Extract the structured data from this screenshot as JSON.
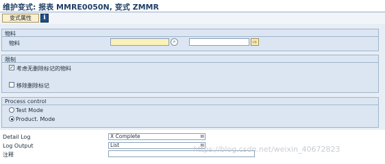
{
  "window": {
    "title": "维护变式: 报表 MMRE0050N, 变式 ZMMR"
  },
  "toolbar": {
    "attributes_button": "变式属性",
    "info_icon_glyph": "i"
  },
  "group_material": {
    "title": "物料",
    "field_label": "物料",
    "from_value": "",
    "to_value": "",
    "match_icon_glyph": "⌕",
    "multiple_icon_glyph": "⇨"
  },
  "group_restrict": {
    "title": "限制",
    "check1_label": "考虑无删除标记的物料",
    "check1_checked": true,
    "check1_glyph": "✓",
    "check2_label": "移除删除标记",
    "check2_checked": false
  },
  "group_process": {
    "title": "Process control",
    "radio1_label": "Test Mode",
    "radio1_selected": false,
    "radio2_label": "Product. Mode",
    "radio2_selected": true
  },
  "log": {
    "detail_label": "Detail Log",
    "detail_value": "X Complete",
    "output_label": "Log Output",
    "output_value": "List",
    "comment_label": "注释",
    "comment_value": "",
    "dropdown_icon_glyph": "▤"
  },
  "watermark": "https://blog.csdn.net/weixin_40672823",
  "colors": {
    "background": "#e8eef6",
    "group_bg": "#dce6f2",
    "title_text": "#1f3f66",
    "required_field": "#fbf2b8"
  }
}
